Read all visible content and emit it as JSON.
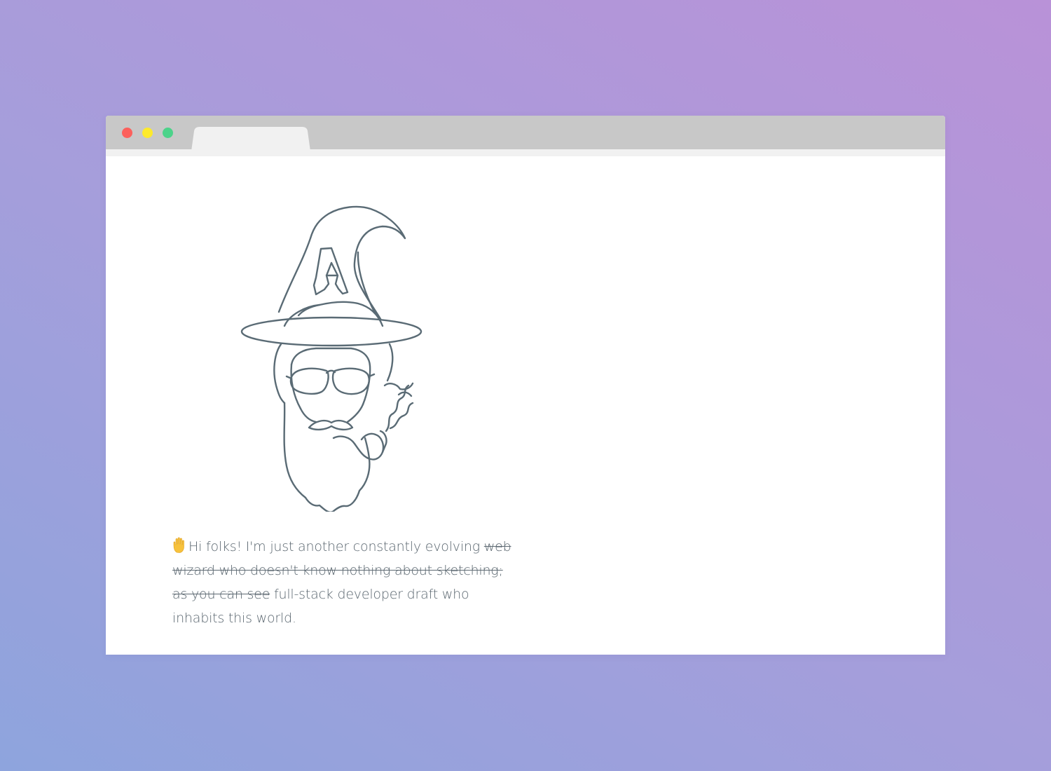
{
  "browser": {
    "tab_title": "",
    "traffic_lights": {
      "close_color": "#fc605c",
      "minimize_color": "#fdea2b",
      "maximize_color": "#4cd38a"
    }
  },
  "content": {
    "illustration_icon": "wizard-illustration-icon",
    "intro": {
      "hand_icon": "raised-hand-emoji",
      "text_before": "Hi folks! I'm just another constantly evolving ",
      "struck_text": "web wizard who doesn't know nothing about sketching; as you can see",
      "text_after": " full-stack developer draft who inhabits this world."
    }
  },
  "colors": {
    "line_art": "#5a6b75",
    "text": "#5b6770",
    "chrome": "#c8c8c8"
  }
}
